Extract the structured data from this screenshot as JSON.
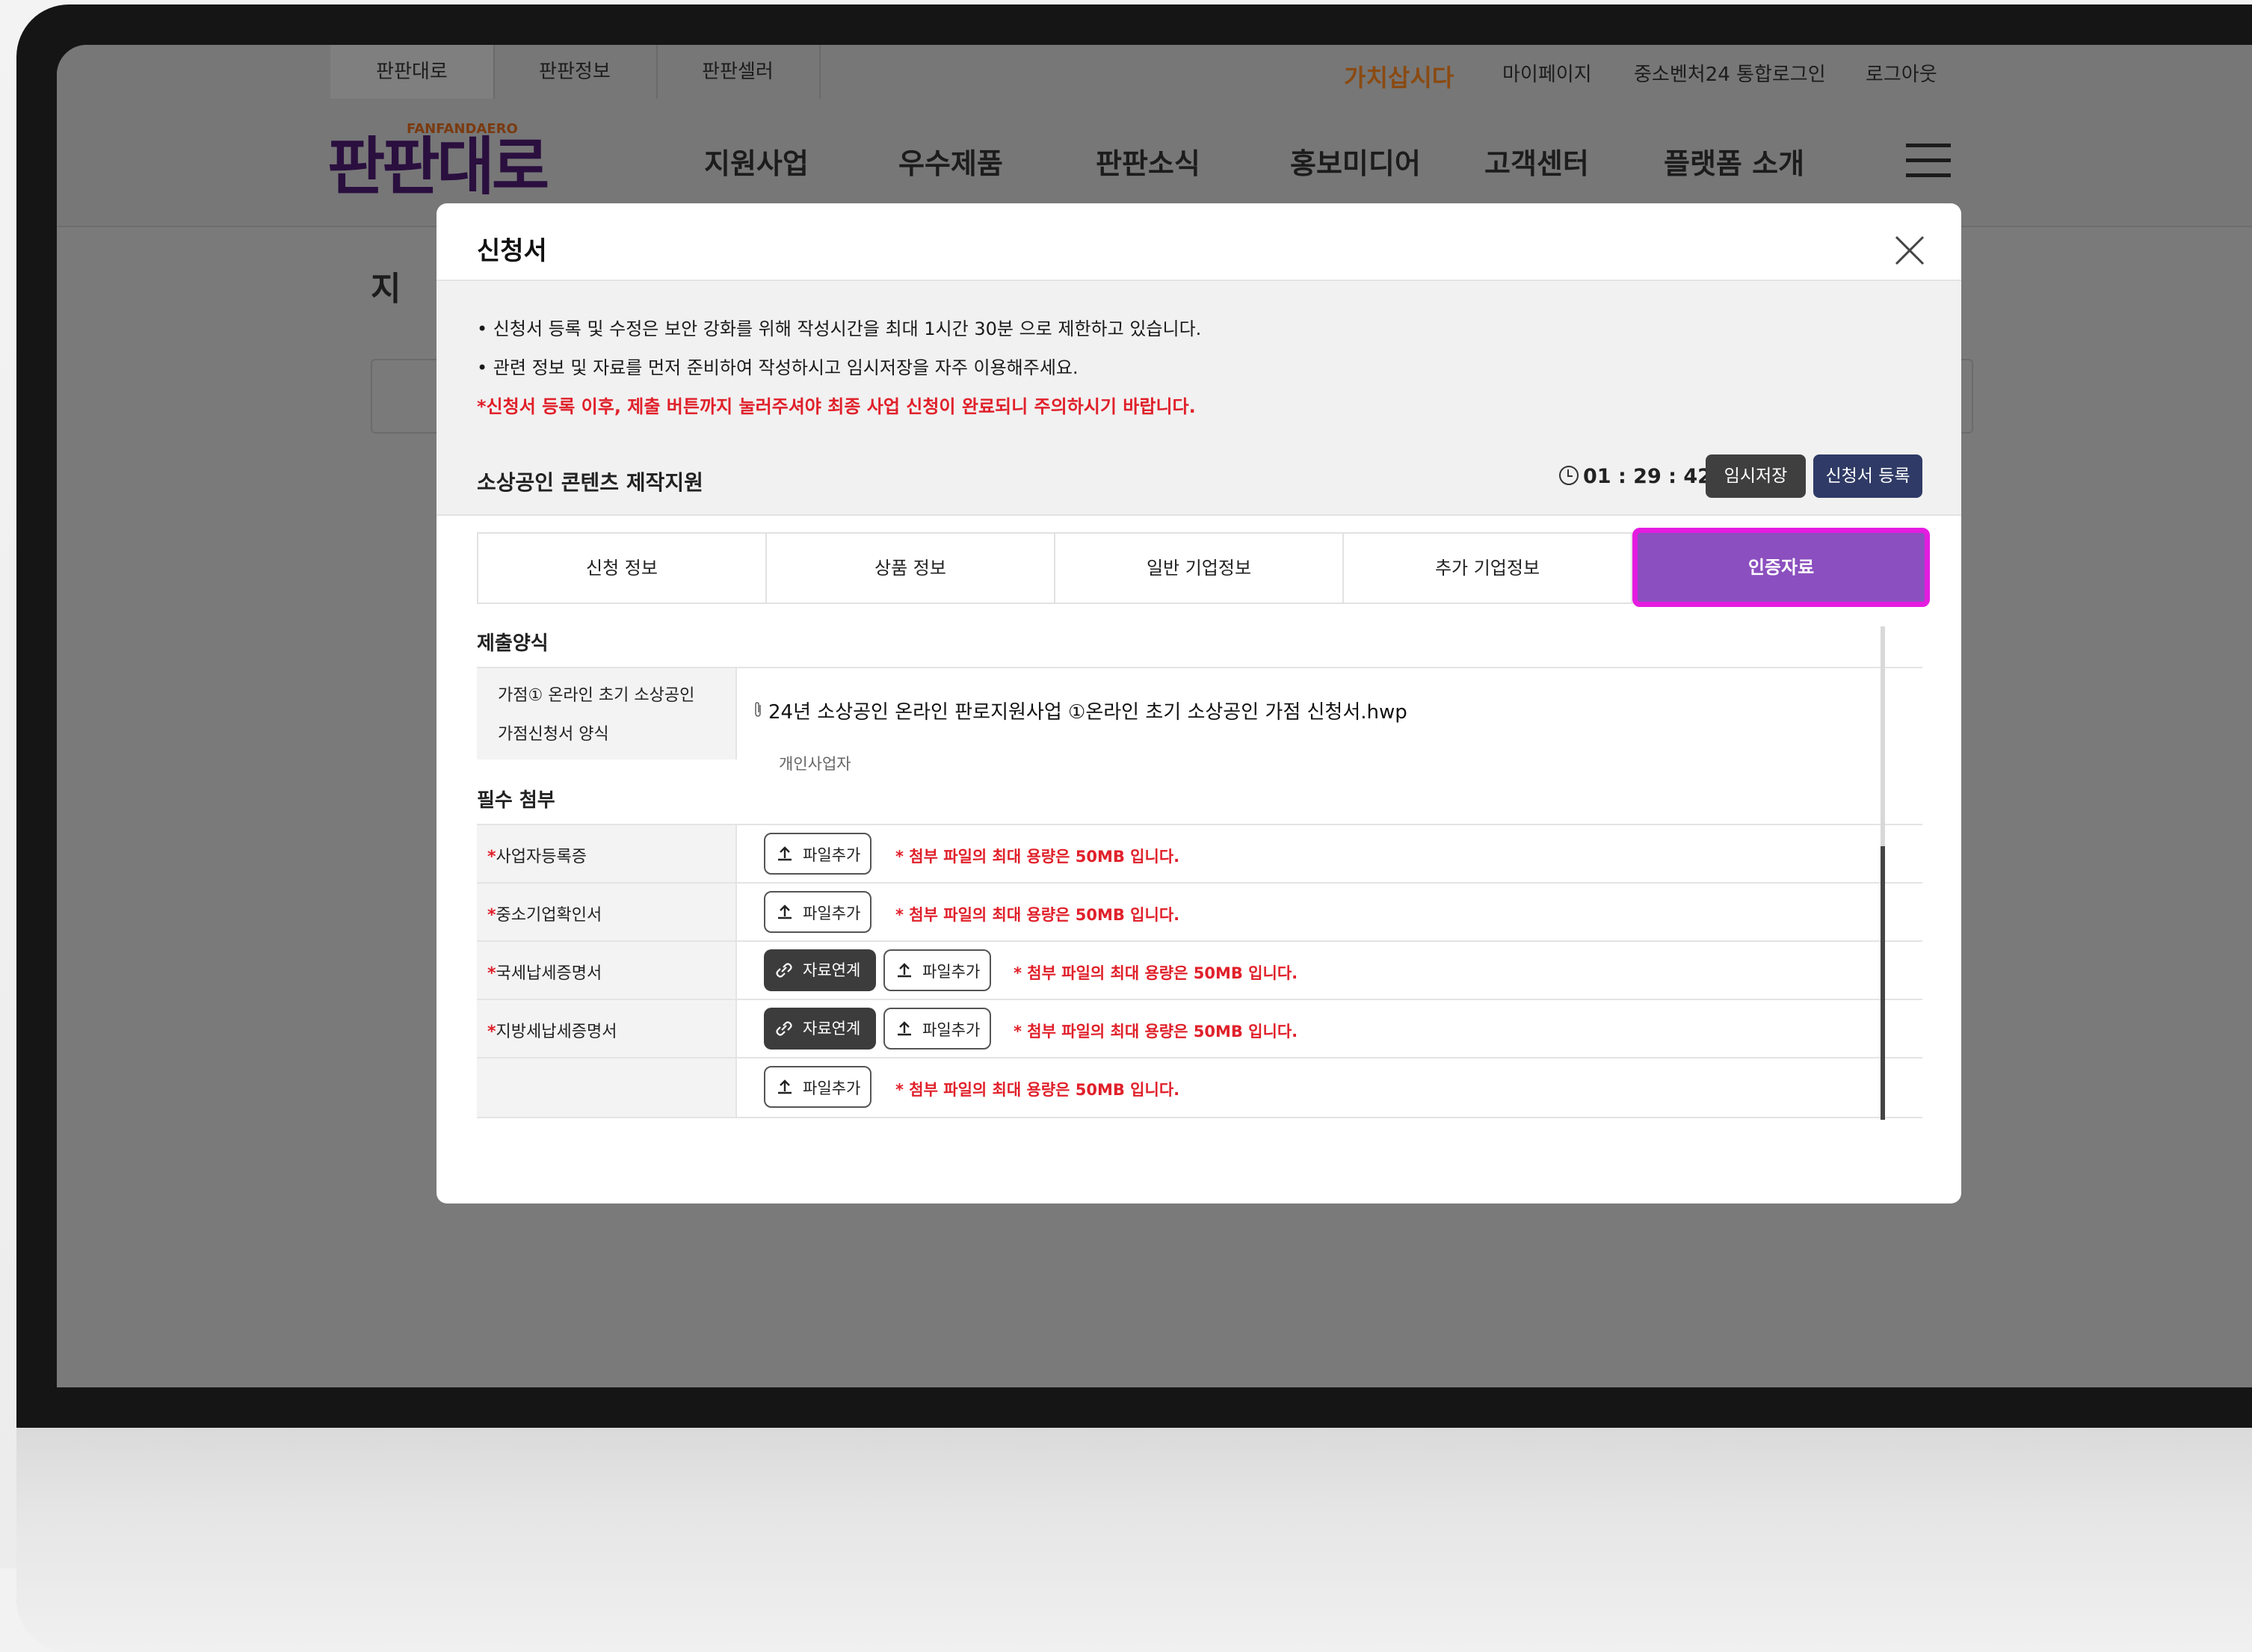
{
  "site": {
    "top_tabs": [
      "판판대로",
      "판판정보",
      "판판셀러"
    ],
    "brand_badge": "가치삽시다",
    "util_links": [
      "마이페이지",
      "중소벤처24 통합로그인",
      "로그아웃"
    ],
    "logo_text": "판판대로",
    "logo_small": "FANFANDAERO",
    "nav_items": [
      "지원사업",
      "우수제품",
      "판판소식",
      "홍보미디어",
      "고객센터",
      "플랫폼 소개"
    ],
    "page_heading": "지"
  },
  "modal": {
    "title": "신청서",
    "notices": [
      "• 신청서 등록 및 수정은 보안 강화를 위해 작성시간을 최대 1시간 30분 으로 제한하고 있습니다.",
      "• 관련 정보 및 자료를 먼저 준비하여 작성하시고 임시저장을 자주 이용해주세요.",
      "*신청서 등록 이후, 제출 버튼까지 눌러주셔야 최종 사업 신청이 완료되니 주의하시기 바랍니다."
    ],
    "form_name": "소상공인 콘텐츠 제작지원",
    "timer": "01 : 29 : 42",
    "temp_save_label": "임시저장",
    "register_label": "신청서 등록",
    "tabs": [
      "신청 정보",
      "상품 정보",
      "일반 기업정보",
      "추가 기업정보",
      "인증자료"
    ],
    "submit_form_section": "제출양식",
    "form_row_label_1": "가점① 온라인 초기 소상공인",
    "form_row_label_2": "가점신청서 양식",
    "form_file": "24년 소상공인 온라인 판로지원사업 ①온라인 초기 소상공인 가점 신청서.hwp",
    "personal_label": "개인사업자",
    "required_section": "필수 첨부",
    "attachments": [
      {
        "label": "사업자등록증",
        "required": "*",
        "link_label": "",
        "add_label": "파일추가",
        "note": "* 첨부 파일의 최대 용량은 50MB 입니다."
      },
      {
        "label": "중소기업확인서",
        "required": "*",
        "link_label": "",
        "add_label": "파일추가",
        "note": "* 첨부 파일의 최대 용량은 50MB 입니다."
      },
      {
        "label": "국세납세증명서",
        "required": "*",
        "link_label": "자료연계",
        "add_label": "파일추가",
        "note": "* 첨부 파일의 최대 용량은 50MB 입니다."
      },
      {
        "label": "지방세납세증명서",
        "required": "*",
        "link_label": "자료연계",
        "add_label": "파일추가",
        "note": "* 첨부 파일의 최대 용량은 50MB 입니다."
      },
      {
        "label": "",
        "required": "",
        "link_label": "",
        "add_label": "파일추가",
        "note": "* 첨부 파일의 최대 용량은 50MB 입니다."
      }
    ]
  },
  "colors": {
    "active_tab": "#8b4fbf",
    "highlight_border": "#e51ce0",
    "warning": "#e0202a",
    "dark_button": "#3c3c3c",
    "register_button": "#2f3b66"
  }
}
